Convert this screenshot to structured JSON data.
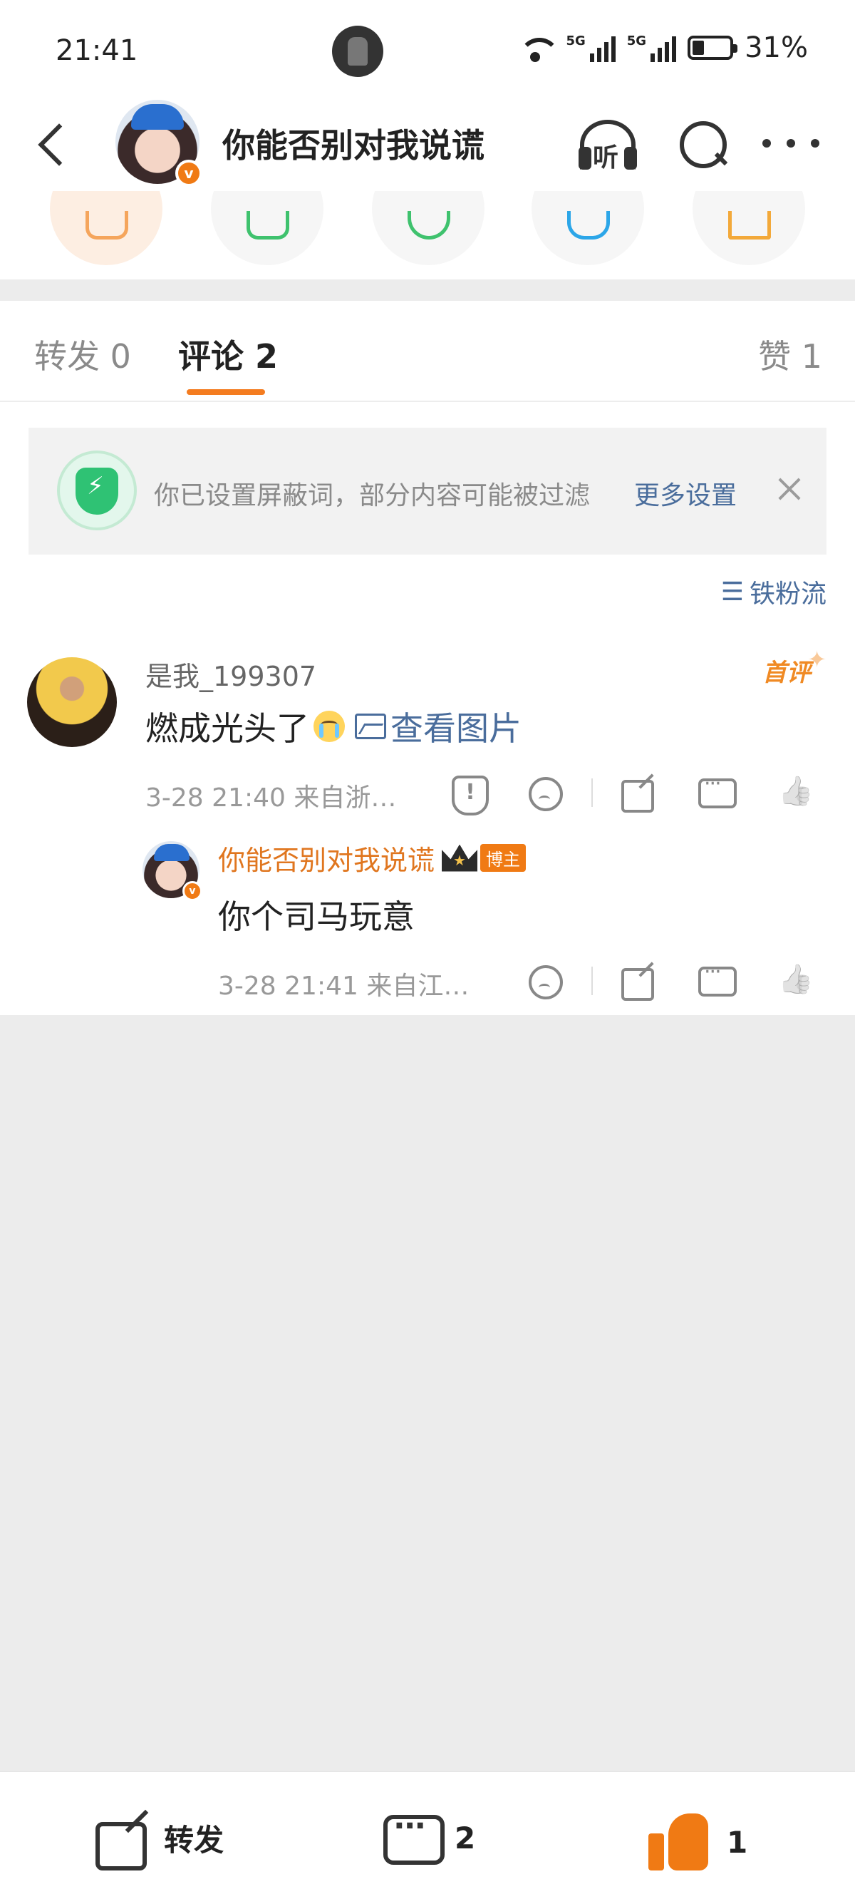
{
  "status_bar": {
    "time": "21:41",
    "network_1": "5G",
    "network_2": "5G",
    "battery": "31%"
  },
  "header": {
    "title": "你能否别对我说谎",
    "listen_label": "听",
    "icons": [
      "back-arrow",
      "headphones-icon",
      "search-icon",
      "more-icon"
    ]
  },
  "share_strip": {
    "icons": [
      "repost-to-story-icon",
      "wechat-icon",
      "moments-icon",
      "qq-icon",
      "save-image-icon"
    ]
  },
  "tabs": {
    "repost": "转发 0",
    "comments": "评论 2",
    "likes": "赞 1",
    "active": "comments"
  },
  "notice": {
    "text": "你已设置屏蔽词，部分内容可能被过滤",
    "link": "更多设置"
  },
  "sort": {
    "label": "铁粉流"
  },
  "comments": [
    {
      "username": "是我_199307",
      "badge": "首评",
      "text": "燃成光头了",
      "image_link": "查看图片",
      "meta": "3-28 21:40  来自浙…",
      "replies": [
        {
          "username": "你能否别对我说谎",
          "host_badge": "博主",
          "text": "你个司马玩意",
          "meta": "3-28 21:41  来自江…"
        }
      ]
    }
  ],
  "bottom_bar": {
    "repost_label": "转发",
    "comment_count": "2",
    "like_count": "1"
  },
  "colors": {
    "accent": "#f47c20",
    "link": "#4a6d9c",
    "host_name": "#e0761f",
    "like_active": "#f07a14"
  }
}
